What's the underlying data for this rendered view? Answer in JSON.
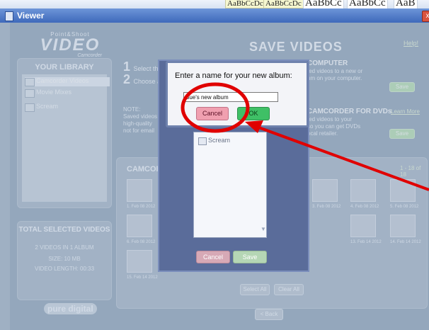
{
  "ribbon": {
    "styles": [
      "AaBbCcDc",
      "AaBbCcDc",
      "AaBbCc",
      "AaBbCc",
      "AaB"
    ]
  },
  "window": {
    "title": "Viewer",
    "close_glyph": "x"
  },
  "brand": {
    "pre": "Point&Shoot",
    "main": "VIDEO",
    "post": "Camcorder",
    "footer": "pure digital",
    "footer_sub": ""
  },
  "header": {
    "title": "SAVE VIDEOS",
    "help": "Help!"
  },
  "library": {
    "title": "YOUR LIBRARY",
    "items": [
      "Camcorder Videos",
      "Movie Mixes",
      "Scream"
    ]
  },
  "totals": {
    "title": "TOTAL SELECTED VIDEOS",
    "count": "2 VIDEOS IN 1 ALBUM",
    "size": "SIZE: 10 MB",
    "length": "VIDEO LENGTH: 00:33"
  },
  "steps": [
    {
      "num": "1",
      "text": "Select the"
    },
    {
      "num": "2",
      "text": "Choose a"
    }
  ],
  "computer": {
    "title": "COMPUTER",
    "line1": "ted videos to a new or",
    "line2": "um on your computer.",
    "button": "Save"
  },
  "note": {
    "label": "NOTE:",
    "line1": "Saved videos",
    "line2": "high-quality",
    "line3": "not for email"
  },
  "dvd": {
    "title": "CAMCORDER FOR DVDs",
    "learn": "Learn More",
    "line1": "ted videos to your",
    "line2": "so you can get DVDs",
    "line3": "ocal retailer.",
    "button": "Save"
  },
  "camcorder": {
    "title": "CAMCOR",
    "range": "1 - 18 of 18",
    "labels_left": [
      "1. Feb 08 2012",
      "6. Feb 08 2012",
      "15. Feb 14 2012"
    ],
    "labels_right_row1": [
      "3. Feb 08 2012",
      "4. Feb 08 2012",
      "5. Feb 08 2012"
    ],
    "labels_right_row2": [
      "13. Feb 14 2012",
      "14. Feb 14 2012"
    ],
    "select_all": "Select All",
    "clear_all": "Clear All",
    "back": "< Back"
  },
  "album_modal": {
    "list_items": [
      "Scream"
    ],
    "cancel": "Cancel",
    "save": "Save"
  },
  "dialog": {
    "prompt": "Enter a name for your new album:",
    "name_value": "Sue's new album",
    "cancel": "Cancel",
    "ok": "OK"
  },
  "annotation": {
    "color": "#e00000"
  }
}
